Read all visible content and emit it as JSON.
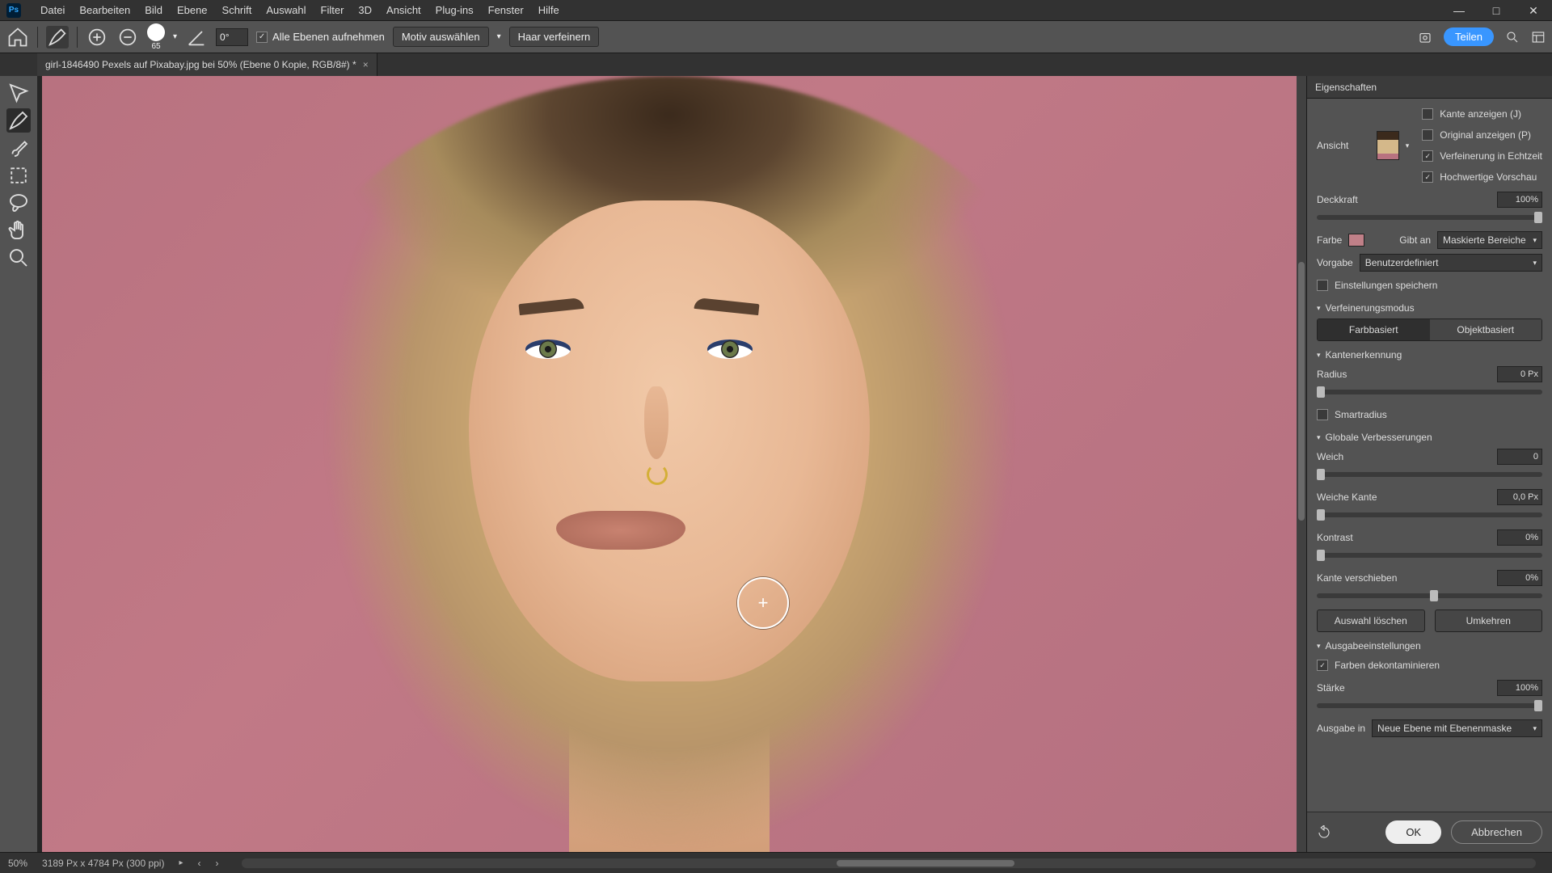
{
  "menu": {
    "items": [
      "Datei",
      "Bearbeiten",
      "Bild",
      "Ebene",
      "Schrift",
      "Auswahl",
      "Filter",
      "3D",
      "Ansicht",
      "Plug-ins",
      "Fenster",
      "Hilfe"
    ]
  },
  "options": {
    "brush_size": "65",
    "angle": "0°",
    "sample_all": "Alle Ebenen aufnehmen",
    "sample_all_checked": true,
    "select_subject": "Motiv auswählen",
    "refine_hair": "Haar verfeinern",
    "share": "Teilen"
  },
  "document": {
    "tab_title": "girl-1846490 Pexels auf Pixabay.jpg bei 50% (Ebene 0 Kopie, RGB/8#) *"
  },
  "status": {
    "zoom": "50%",
    "dims": "3189 Px x 4784 Px (300 ppi)"
  },
  "props": {
    "title": "Eigenschaften",
    "view_label": "Ansicht",
    "show_edge": "Kante anzeigen (J)",
    "show_original": "Original anzeigen (P)",
    "realtime_refine": "Verfeinerung in Echtzeit",
    "hq_preview": "Hochwertige Vorschau",
    "opacity_label": "Deckkraft",
    "opacity_value": "100%",
    "color_label": "Farbe",
    "indicates_label": "Gibt an",
    "indicates_value": "Maskierte Bereiche",
    "preset_label": "Vorgabe",
    "preset_value": "Benutzerdefiniert",
    "remember": "Einstellungen speichern",
    "refine_mode": "Verfeinerungsmodus",
    "mode_color": "Farbbasiert",
    "mode_object": "Objektbasiert",
    "edge_detect": "Kantenerkennung",
    "radius_label": "Radius",
    "radius_value": "0 Px",
    "smart_radius": "Smartradius",
    "global": "Globale Verbesserungen",
    "smooth_label": "Weich",
    "smooth_value": "0",
    "feather_label": "Weiche Kante",
    "feather_value": "0,0 Px",
    "contrast_label": "Kontrast",
    "contrast_value": "0%",
    "shift_label": "Kante verschieben",
    "shift_value": "0%",
    "clear_sel": "Auswahl löschen",
    "invert": "Umkehren",
    "output": "Ausgabeeinstellungen",
    "decon": "Farben dekontaminieren",
    "amount_label": "Stärke",
    "amount_value": "100%",
    "output_to_label": "Ausgabe in",
    "output_to_value": "Neue Ebene mit Ebenenmaske",
    "ok": "OK",
    "cancel": "Abbrechen"
  }
}
